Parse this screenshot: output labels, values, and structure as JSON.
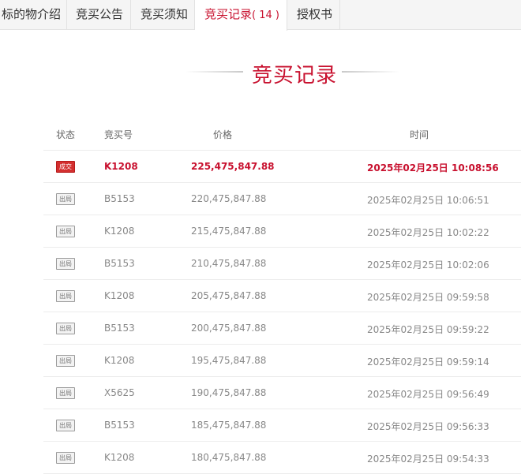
{
  "tabs": [
    {
      "label": "标的物介绍"
    },
    {
      "label": "竞买公告"
    },
    {
      "label": "竞买须知"
    },
    {
      "label": "竞买记录",
      "count": "( 14 )"
    },
    {
      "label": "授权书"
    }
  ],
  "section": {
    "title": "竞买记录"
  },
  "table": {
    "headers": {
      "status": "状态",
      "bid_no": "竞买号",
      "price": "价格",
      "time": "时间"
    },
    "rows": [
      {
        "status": "成交",
        "bid_no": "K1208",
        "price": "225,475,847.88",
        "time": "2025年02月25日 10:08:56"
      },
      {
        "status": "出局",
        "bid_no": "B5153",
        "price": "220,475,847.88",
        "time": "2025年02月25日 10:06:51"
      },
      {
        "status": "出局",
        "bid_no": "K1208",
        "price": "215,475,847.88",
        "time": "2025年02月25日 10:02:22"
      },
      {
        "status": "出局",
        "bid_no": "B5153",
        "price": "210,475,847.88",
        "time": "2025年02月25日 10:02:06"
      },
      {
        "status": "出局",
        "bid_no": "K1208",
        "price": "205,475,847.88",
        "time": "2025年02月25日 09:59:58"
      },
      {
        "status": "出局",
        "bid_no": "B5153",
        "price": "200,475,847.88",
        "time": "2025年02月25日 09:59:22"
      },
      {
        "status": "出局",
        "bid_no": "K1208",
        "price": "195,475,847.88",
        "time": "2025年02月25日 09:59:14"
      },
      {
        "status": "出局",
        "bid_no": "X5625",
        "price": "190,475,847.88",
        "time": "2025年02月25日 09:56:49"
      },
      {
        "status": "出局",
        "bid_no": "B5153",
        "price": "185,475,847.88",
        "time": "2025年02月25日 09:56:33"
      },
      {
        "status": "出局",
        "bid_no": "K1208",
        "price": "180,475,847.88",
        "time": "2025年02月25日 09:54:33"
      }
    ]
  },
  "colors": {
    "accent": "#c8102e",
    "deal_badge": "#d32f2f",
    "tab_bar": "#f5f5f5"
  }
}
